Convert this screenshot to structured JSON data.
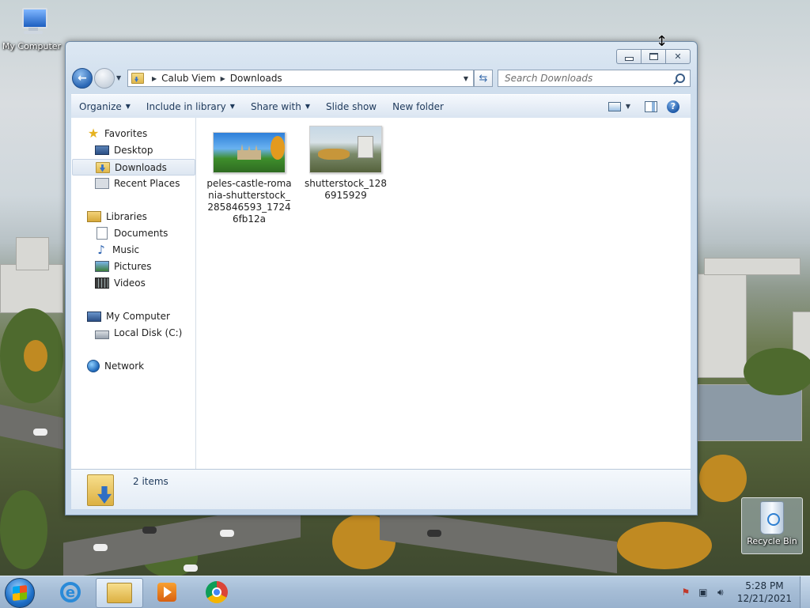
{
  "desktop": {
    "icons": [
      {
        "label": "My Computer"
      },
      {
        "label": "Recycle Bin"
      }
    ]
  },
  "window": {
    "caption_buttons": {
      "minimize": "minimize",
      "maximize": "maximize",
      "close": "close"
    },
    "address": {
      "crumbs": [
        "Calub Viem",
        "Downloads"
      ]
    },
    "search": {
      "placeholder": "Search Downloads"
    },
    "commands": {
      "organize": "Organize",
      "include_in_library": "Include in library",
      "share_with": "Share with",
      "slide_show": "Slide show",
      "new_folder": "New folder"
    },
    "nav": {
      "favorites": "Favorites",
      "desktop": "Desktop",
      "downloads": "Downloads",
      "recent_places": "Recent Places",
      "libraries": "Libraries",
      "documents": "Documents",
      "music": "Music",
      "pictures": "Pictures",
      "videos": "Videos",
      "my_computer": "My Computer",
      "local_disk": "Local Disk (C:)",
      "network": "Network"
    },
    "files": [
      {
        "name": "peles-castle-romania-shutterstock_285846593_17246fb12a"
      },
      {
        "name": "shutterstock_1286915929"
      }
    ],
    "details": {
      "count": "2 items"
    }
  },
  "taskbar": {
    "clock": {
      "time": "5:28 PM",
      "date": "12/21/2021"
    }
  },
  "colors": {
    "accent": "#2a67b5",
    "taskbar": "#a6bdd6",
    "command_text": "#1e395b"
  }
}
